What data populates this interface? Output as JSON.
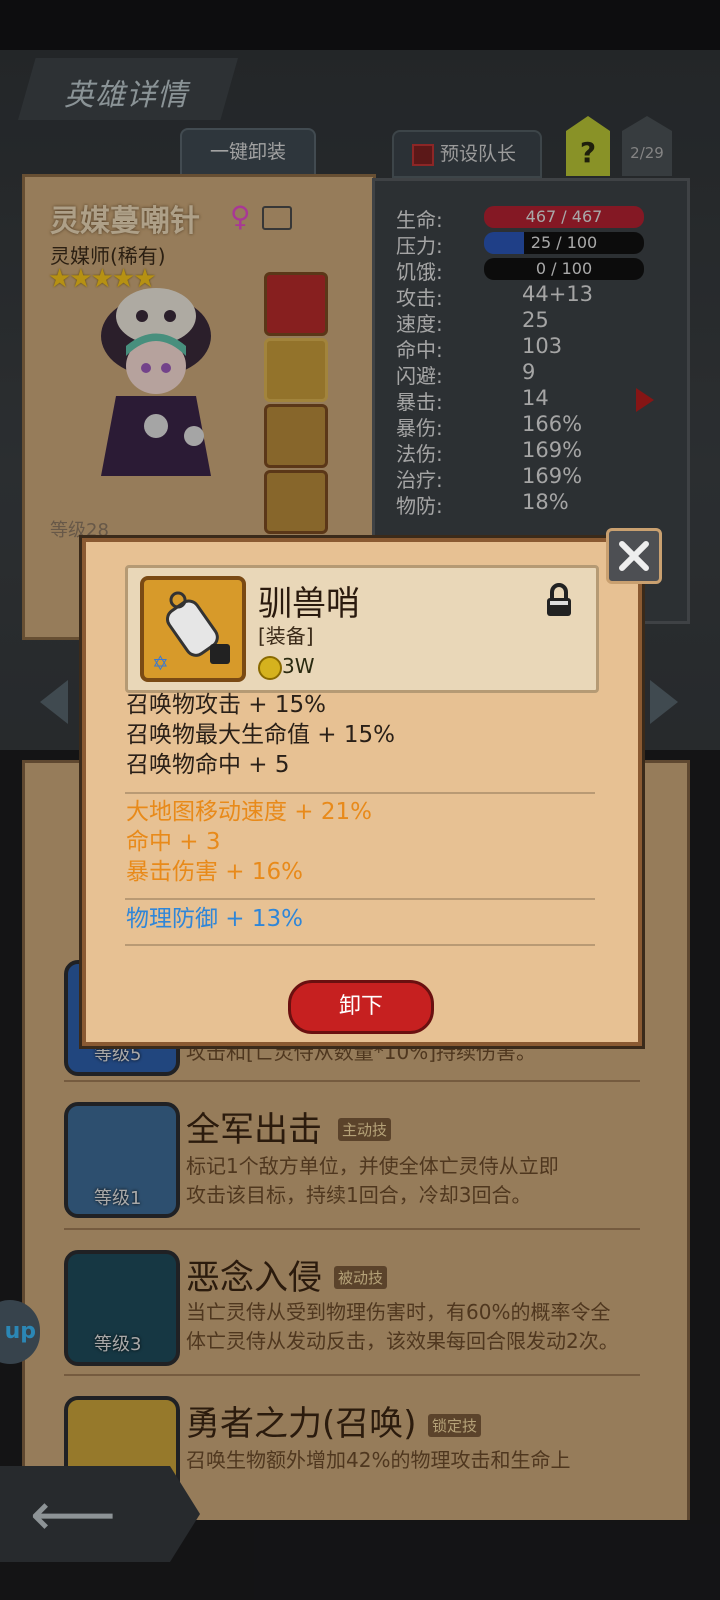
{
  "header": {
    "title": "英雄详情",
    "one_click_unequip": "一键卸装",
    "preset_captain": "预设队长",
    "help": "?",
    "page_counter": "2/29"
  },
  "hero": {
    "name": "灵媒蔓嘲针",
    "gender_symbol": "♀",
    "class": "灵媒师(稀有)",
    "stars": "★★★★★",
    "level": "等级28"
  },
  "stats": {
    "life": {
      "label": "生命:",
      "value": "467 / 467",
      "fill": 1.0,
      "color": "#b02030"
    },
    "pressure": {
      "label": "压力:",
      "value": "25 / 100",
      "fill": 0.25,
      "color": "#2a55b5"
    },
    "hunger": {
      "label": "饥饿:",
      "value": "0 / 100",
      "fill": 0.0,
      "color": "#333333"
    },
    "rows": [
      {
        "label": "攻击:",
        "value": "44+13"
      },
      {
        "label": "速度:",
        "value": "25"
      },
      {
        "label": "命中:",
        "value": "103"
      },
      {
        "label": "闪避:",
        "value": "9"
      },
      {
        "label": "暴击:",
        "value": "14"
      },
      {
        "label": "暴伤:",
        "value": "166%"
      },
      {
        "label": "法伤:",
        "value": "169%"
      },
      {
        "label": "治疗:",
        "value": "169%"
      },
      {
        "label": "物防:",
        "value": "18%"
      }
    ]
  },
  "skills": [
    {
      "level": "等级5",
      "desc": "攻击和[亡灵侍从数量*10%]持续伤害。"
    },
    {
      "name": "全军出击",
      "tag": "主动技",
      "level": "等级1",
      "desc1": "标记1个敌方单位，并使全体亡灵侍从立即",
      "desc2": "攻击该目标，持续1回合，冷却3回合。"
    },
    {
      "name": "恶念入侵",
      "tag": "被动技",
      "level": "等级3",
      "desc1": "当亡灵侍从受到物理伤害时，有60%的概率令全",
      "desc2": "体亡灵侍从发动反击，该效果每回合限发动2次。"
    },
    {
      "name": "勇者之力(召唤)",
      "tag": "锁定技",
      "desc1": "召唤生物额外增加42%的物理攻击和生命上"
    }
  ],
  "side_bubble": "up",
  "popup": {
    "item_name": "驯兽哨",
    "item_type": "[装备]",
    "price": "3W",
    "base_attrs": [
      "召唤物攻击 + 15%",
      "召唤物最大生命值 + 15%",
      "召唤物命中 + 5"
    ],
    "orange_attrs": [
      "大地图移动速度 + 21%",
      "命中 + 3",
      "暴击伤害 + 16%"
    ],
    "blue_attrs": [
      "物理防御 + 13%"
    ],
    "remove_button": "卸下"
  },
  "colors": {
    "parchment": "#e7c193",
    "orange_attr": "#e88a1a",
    "blue_attr": "#2f86d8",
    "button_red": "#c62020"
  }
}
